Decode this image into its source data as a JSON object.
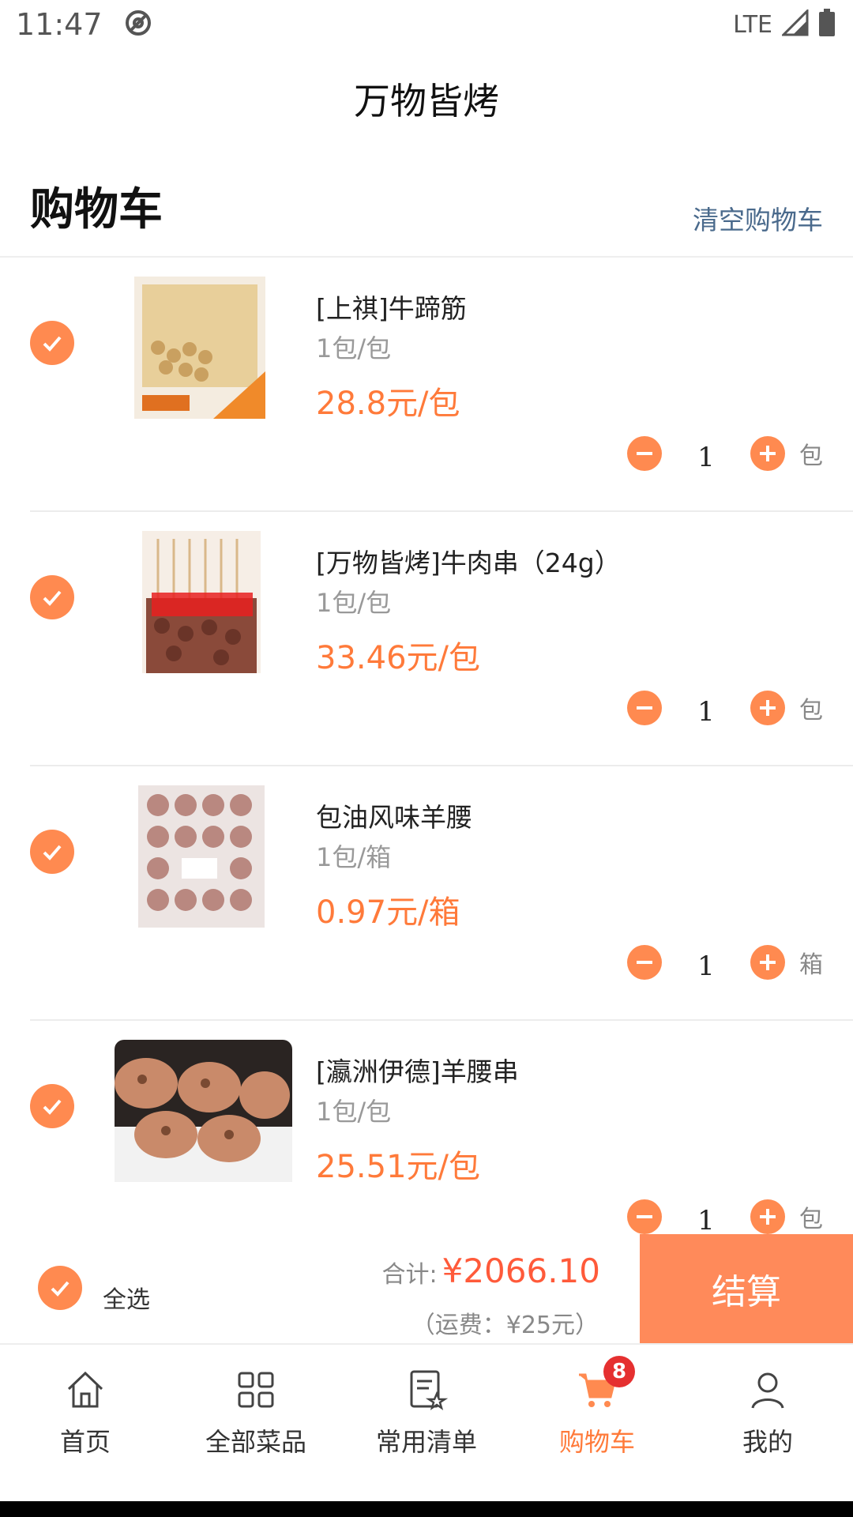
{
  "status_bar": {
    "time": "11:47",
    "network": "LTE"
  },
  "app_title": "万物皆烤",
  "cart": {
    "heading": "购物车",
    "clear_label": "清空购物车",
    "items": [
      {
        "name": "[上祺]牛蹄筋",
        "unit": "1包/包",
        "price": "28.8元/包",
        "qty": "1",
        "qty_unit": "包"
      },
      {
        "name": "[万物皆烤]牛肉串（24g）",
        "unit": "1包/包",
        "price": "33.46元/包",
        "qty": "1",
        "qty_unit": "包"
      },
      {
        "name": "包油风味羊腰",
        "unit": "1包/箱",
        "price": "0.97元/箱",
        "qty": "1",
        "qty_unit": "箱"
      },
      {
        "name": "[瀛洲伊德]羊腰串",
        "unit": "1包/包",
        "price": "25.51元/包",
        "qty": "1",
        "qty_unit": "包"
      }
    ]
  },
  "summary": {
    "select_all": "全选",
    "total_label": "合计:",
    "total_value": "¥2066.10",
    "shipping": "（运费：¥25元）",
    "checkout": "结算"
  },
  "nav": {
    "items": [
      {
        "label": "首页",
        "icon": "home-icon"
      },
      {
        "label": "全部菜品",
        "icon": "grid-icon"
      },
      {
        "label": "常用清单",
        "icon": "list-star-icon"
      },
      {
        "label": "购物车",
        "icon": "cart-icon",
        "badge": "8",
        "active": true
      },
      {
        "label": "我的",
        "icon": "person-icon"
      }
    ]
  },
  "colors": {
    "accent": "#ff8a50",
    "price": "#ff7a3a",
    "total": "#ff5a3a",
    "badge": "#e53030",
    "link": "#4a6a8c"
  }
}
